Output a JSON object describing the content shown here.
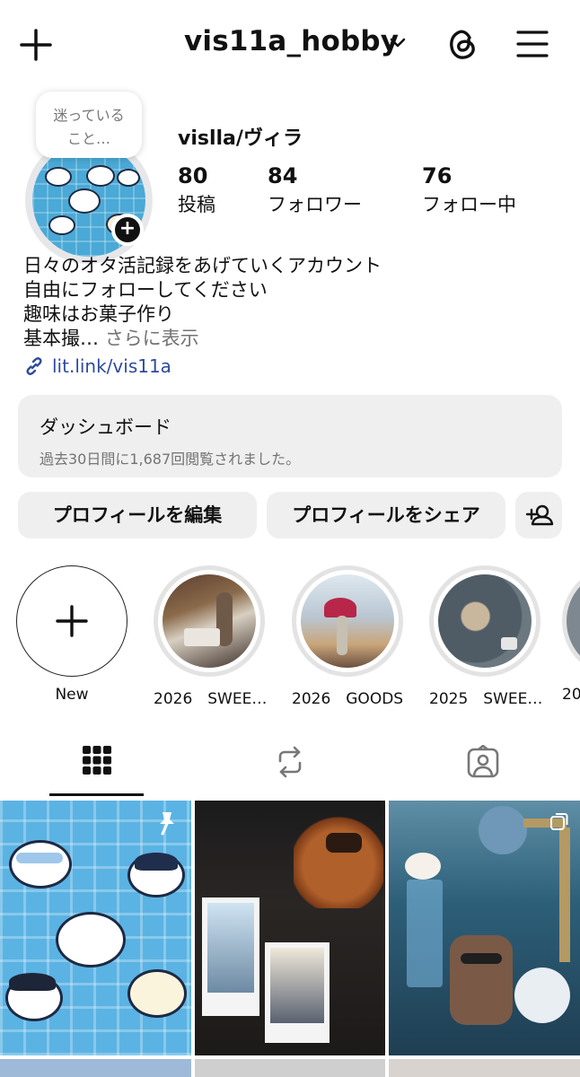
{
  "header": {
    "username": "vis11a_hobby",
    "icons": [
      "plus-icon",
      "chevron-down-icon",
      "threads-icon",
      "menu-icon"
    ]
  },
  "profile": {
    "note": [
      "迷っている",
      "こと…"
    ],
    "display_name": "vislla/ヴィラ",
    "stats": [
      {
        "value": "80",
        "label": "投稿"
      },
      {
        "value": "84",
        "label": "フォロワー"
      },
      {
        "value": "76",
        "label": "フォロー中"
      }
    ],
    "bio": [
      "日々のオタ活記録をあげていくアカウント",
      "自由にフォローしてください",
      "趣味はお菓子作り"
    ],
    "bio_truncated": "基本撮…",
    "bio_more": "さらに表示",
    "link": "lit.link/vis11a"
  },
  "dashboard": {
    "title": "ダッシュボード",
    "subtitle": "過去30日間に1,687回閲覧されました。"
  },
  "buttons": {
    "edit": "プロフィールを編集",
    "share": "プロフィールをシェア",
    "add_person_icon": "add-person-icon"
  },
  "highlights": [
    {
      "label": "New"
    },
    {
      "label": "2026　SWEE…"
    },
    {
      "label": "2026　GOODS"
    },
    {
      "label": "2025　SWEE…"
    },
    {
      "label": "20"
    }
  ],
  "tabs": [
    "grid-icon",
    "reposts-icon",
    "tagged-icon"
  ],
  "colors": {
    "link": "#2d4b9f",
    "muted": "#737373",
    "button_bg": "#efefef",
    "avatar_bg": "#4aa9d6"
  }
}
